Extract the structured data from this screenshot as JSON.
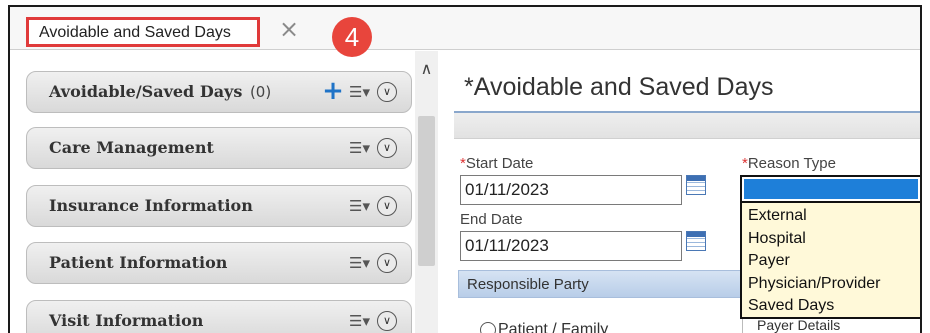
{
  "tab": {
    "label": "Avoidable and Saved Days",
    "close_symbol": "×",
    "step_badge": "4"
  },
  "left_panel": {
    "sections": [
      {
        "title": "Avoidable/Saved Days",
        "count": "(0)"
      },
      {
        "title": "Care Management"
      },
      {
        "title": "Insurance Information"
      },
      {
        "title": "Patient Information"
      },
      {
        "title": "Visit Information"
      }
    ],
    "icons": {
      "add": "plus-icon",
      "menu": "list-menu-icon",
      "collapse": "chevron-down-circle-icon",
      "scroll_up": "chevron-up-icon"
    }
  },
  "form": {
    "title": "*Avoidable and Saved Days",
    "start_date": {
      "required_mark": "*",
      "label": "Start Date",
      "value": "01/11/2023"
    },
    "end_date": {
      "label": "End Date",
      "value": "01/11/2023"
    },
    "reason_type": {
      "required_mark": "*",
      "label": "Reason Type",
      "selected": "",
      "options": [
        "External",
        "Hospital",
        "Payer",
        "Physician/Provider",
        "Saved Days"
      ]
    },
    "responsible_party": {
      "header": "Responsible Party",
      "radio_option": "Patient / Family",
      "payer_details": "Payer Details"
    }
  },
  "colors": {
    "badge": "#e8453c",
    "tab_highlight": "#e03a3a",
    "accent_blue": "#1f73c7",
    "dropdown_bg": "#fff9d9",
    "selected_option": "#1e7fd9"
  }
}
